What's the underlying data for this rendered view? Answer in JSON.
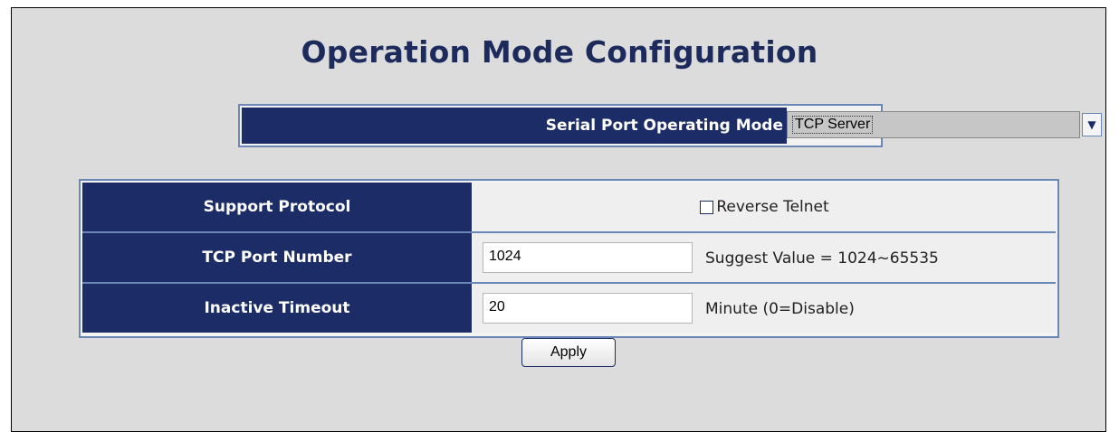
{
  "page": {
    "title": "Operation Mode Configuration"
  },
  "mode": {
    "label": "Serial Port Operating Mode",
    "selected": "TCP Server"
  },
  "table": {
    "rows": [
      {
        "label": "Support Protocol",
        "checkbox_label": "Reverse Telnet",
        "checked": false
      },
      {
        "label": "TCP Port Number",
        "value": "1024",
        "hint": "Suggest Value = 1024~65535"
      },
      {
        "label": "Inactive Timeout",
        "value": "20",
        "hint": "Minute (0=Disable)"
      }
    ]
  },
  "actions": {
    "apply_label": "Apply"
  },
  "colors": {
    "header_bg": "#1b2c66",
    "title_color": "#1c2a5c",
    "border_accent": "#6a87b5",
    "page_bg": "#dcdcdc"
  }
}
